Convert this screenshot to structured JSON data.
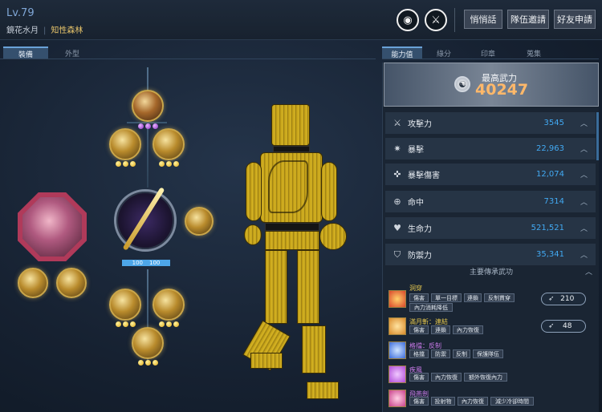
{
  "header": {
    "level": "Lv.79",
    "char_name": "鏡花水月",
    "guild_name": "知性森林",
    "buttons": [
      "悄悄話",
      "隊伍邀請",
      "好友申請"
    ],
    "icons": [
      "emblem-icon",
      "sword-badge-icon"
    ]
  },
  "left_tabs": [
    {
      "label": "裝備",
      "active": true
    },
    {
      "label": "外型",
      "active": false
    }
  ],
  "right_tabs": [
    {
      "label": "能力值",
      "active": true
    },
    {
      "label": "綠分",
      "active": false
    },
    {
      "label": "印章",
      "active": false
    },
    {
      "label": "蒐集",
      "active": false
    }
  ],
  "equipment": {
    "weapon_durability": {
      "current": "100",
      "max": "100"
    }
  },
  "power": {
    "label": "最高武力",
    "value": "40247"
  },
  "stats": [
    {
      "icon": "⚔",
      "icon_name": "attack-icon",
      "label": "攻擊力",
      "value": "3545"
    },
    {
      "icon": "✷",
      "icon_name": "critical-icon",
      "label": "暴擊",
      "value": "22,963"
    },
    {
      "icon": "✜",
      "icon_name": "critical-damage-icon",
      "label": "暴擊傷害",
      "value": "12,074"
    },
    {
      "icon": "⊕",
      "icon_name": "accuracy-icon",
      "label": "命中",
      "value": "7314"
    },
    {
      "icon": "♥",
      "icon_name": "health-icon",
      "label": "生命力",
      "value": "521,521"
    },
    {
      "icon": "⛉",
      "icon_name": "defense-icon",
      "label": "防禦力",
      "value": "35,341"
    }
  ],
  "skills_section": {
    "title": "主要傳承武功",
    "skills": [
      {
        "name": "洞穿",
        "name_color": "#e6c84e",
        "icon_color": "#d8452a",
        "tags": [
          "傷害",
          "單一目標",
          "連鎖",
          "反制貫穿",
          "內力消耗降低"
        ],
        "count": "210"
      },
      {
        "name": "滿月斬：連結",
        "name_color": "#e6c84e",
        "icon_color": "#d98a2a",
        "tags": [
          "傷害",
          "連鎖",
          "內力恢復"
        ],
        "count": "48"
      },
      {
        "name": "格擋：反制",
        "name_color": "#c87ae8",
        "icon_color": "#3a6ad8",
        "tags": [
          "格擋",
          "防禦",
          "反制",
          "保護隊伍"
        ],
        "count": ""
      },
      {
        "name": "疾風",
        "name_color": "#c87ae8",
        "icon_color": "#b04ad8",
        "tags": [
          "傷害",
          "內力恢復",
          "額外恢復內力"
        ],
        "count": ""
      },
      {
        "name": "飛燕劍",
        "name_color": "#c87ae8",
        "icon_color": "#c8408a",
        "tags": [
          "傷害",
          "投射物",
          "內力恢復",
          "減少冷卻時間"
        ],
        "count": ""
      }
    ]
  }
}
